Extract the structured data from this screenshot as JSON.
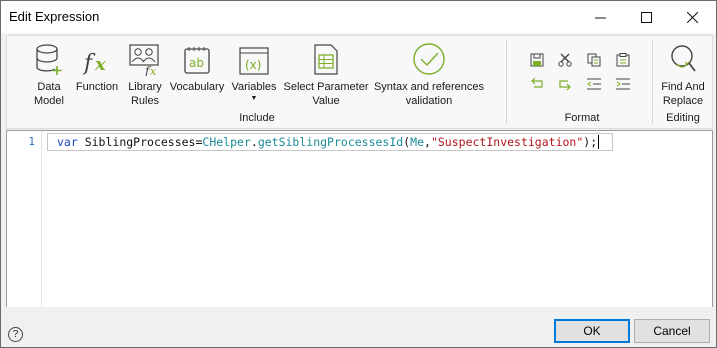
{
  "window": {
    "title": "Edit Expression",
    "controls": {
      "minimize": "–",
      "maximize": "☐",
      "close": "✕"
    }
  },
  "ribbon": {
    "include_group": {
      "label": "Include",
      "items": [
        {
          "name": "data-model",
          "label": "Data\nModel",
          "icon": "database-add-icon"
        },
        {
          "name": "function",
          "label": "Function",
          "icon": "fx-icon"
        },
        {
          "name": "library-rules",
          "label": "Library\nRules",
          "icon": "people-fx-icon"
        },
        {
          "name": "vocabulary",
          "label": "Vocabulary",
          "icon": "ab-icon"
        },
        {
          "name": "variables",
          "label": "Variables",
          "icon": "x-window-icon"
        },
        {
          "name": "select-parameter-value",
          "label": "Select Parameter\nValue",
          "icon": "table-doc-icon"
        },
        {
          "name": "syntax-validation",
          "label": "Syntax and references\nvalidation",
          "icon": "check-circle-icon"
        }
      ]
    },
    "format_group": {
      "label": "Format"
    },
    "editing_group": {
      "label": "Editing",
      "find_replace": {
        "label": "Find And\nReplace",
        "icon": "search-replace-icon"
      }
    },
    "colors": {
      "accent_green": "#7cae2a"
    }
  },
  "editor": {
    "line_number": "1",
    "tokens": {
      "kw": "var",
      "ident": " SiblingProcesses=",
      "cls": "CHelper",
      "dot": ".",
      "fn": "getSiblingProcessesId",
      "open": "(",
      "me": "Me",
      "comma": ",",
      "str": "\"SuspectInvestigation\"",
      "close": ");"
    }
  },
  "footer": {
    "help_icon": "?",
    "ok_label": "OK",
    "cancel_label": "Cancel"
  }
}
